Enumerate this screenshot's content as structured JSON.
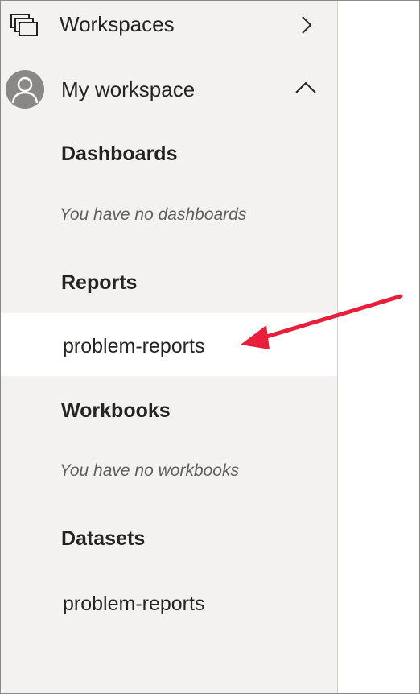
{
  "nav": {
    "workspaces": {
      "label": "Workspaces",
      "icon": "workspaces-icon",
      "chevron": "chevron-right-icon"
    },
    "my_workspace": {
      "label": "My workspace",
      "icon": "avatar-icon",
      "chevron": "chevron-up-icon",
      "expanded": true
    },
    "sections": {
      "dashboards": {
        "heading": "Dashboards",
        "empty_text": "You have no dashboards"
      },
      "reports": {
        "heading": "Reports",
        "items": [
          {
            "label": "problem-reports",
            "selected": true
          }
        ]
      },
      "workbooks": {
        "heading": "Workbooks",
        "empty_text": "You have no workbooks"
      },
      "datasets": {
        "heading": "Datasets",
        "items": [
          {
            "label": "problem-reports",
            "selected": false
          }
        ]
      }
    }
  },
  "annotation": {
    "arrow_color": "#e81e3c",
    "points_to": "reports-item-problem-reports"
  },
  "colors": {
    "nav_background": "#f3f2f1",
    "selected_background": "#ffffff",
    "text": "#252423",
    "muted_text": "#605e5c"
  }
}
